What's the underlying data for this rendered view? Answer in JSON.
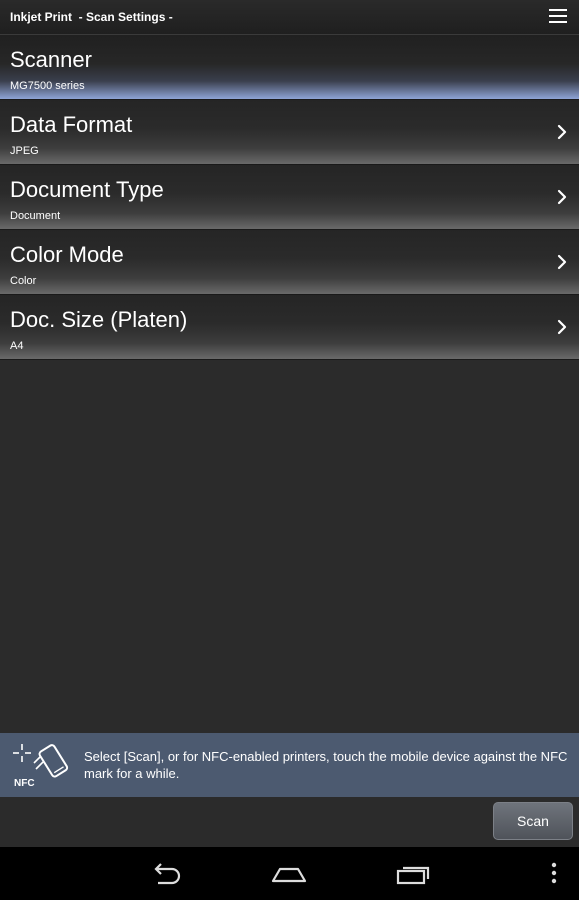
{
  "action_bar": {
    "title": "Inkjet Print  - Scan Settings -",
    "menu_icon": "overflow-menu-icon"
  },
  "settings": [
    {
      "label": "Scanner",
      "value": "MG7500 series",
      "selected": true
    },
    {
      "label": "Data Format",
      "value": "JPEG",
      "chevron": true
    },
    {
      "label": "Document Type",
      "value": "Document",
      "chevron": true
    },
    {
      "label": "Color Mode",
      "value": "Color",
      "chevron": true
    },
    {
      "label": "Doc. Size (Platen)",
      "value": "A4",
      "chevron": true
    }
  ],
  "nfc": {
    "icon_label": "NFC",
    "message": "Select [Scan], or for NFC-enabled printers, touch the mobile device against the NFC mark for a while."
  },
  "buttons": {
    "scan_label": "Scan"
  },
  "nav": {
    "back_icon": "back-icon",
    "home_icon": "home-icon",
    "recents_icon": "recent-apps-icon",
    "more_icon": "more-vertical-icon"
  },
  "colors": {
    "background": "#2b2b2b",
    "nfc_bar": "#4c5a70",
    "selection_highlight": "#8ea4d6"
  }
}
